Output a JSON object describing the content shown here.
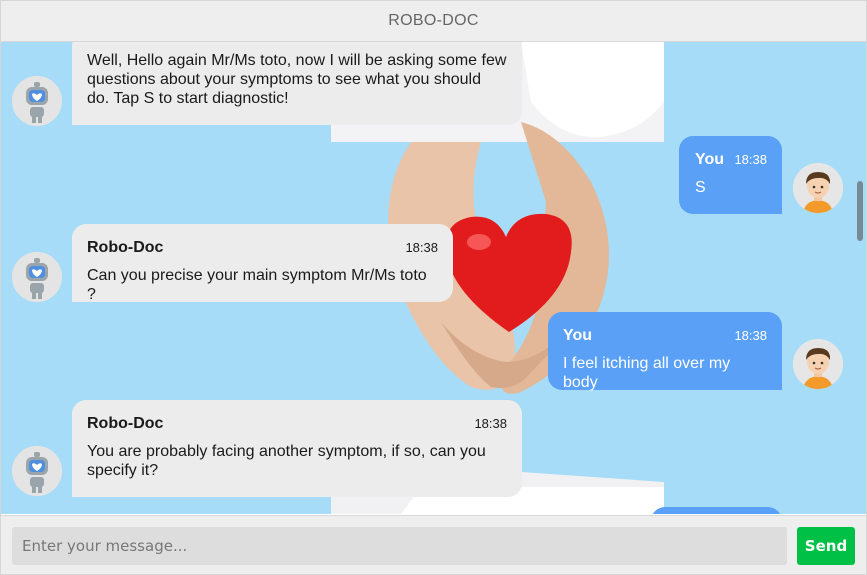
{
  "window": {
    "title": "ROBO-DOC"
  },
  "messages": [
    {
      "side": "bot",
      "name": "",
      "time": "",
      "text": "Well, Hello again Mr/Ms toto, now I will be asking some few questions about your symptoms to see what you should do. Tap S to start diagnostic!"
    },
    {
      "side": "user",
      "name": "You",
      "time": "18:38",
      "text": "S"
    },
    {
      "side": "bot",
      "name": "Robo-Doc",
      "time": "18:38",
      "text": "Can you precise your main symptom Mr/Ms toto ?"
    },
    {
      "side": "user",
      "name": "You",
      "time": "18:38",
      "text": "I feel itching all over my body"
    },
    {
      "side": "bot",
      "name": "Robo-Doc",
      "time": "18:38",
      "text": "You are probably facing another symptom, if so, can you specify it?"
    }
  ],
  "composer": {
    "placeholder": "Enter your message...",
    "value": "",
    "send_label": "Send"
  },
  "colors": {
    "chat_background": "#a6dcf7",
    "bot_bubble": "#ececec",
    "user_bubble": "#5aa0f7",
    "send_button": "#00c045"
  },
  "icons": {
    "bot_avatar": "robot-avatar-icon",
    "user_avatar": "user-avatar-icon"
  }
}
